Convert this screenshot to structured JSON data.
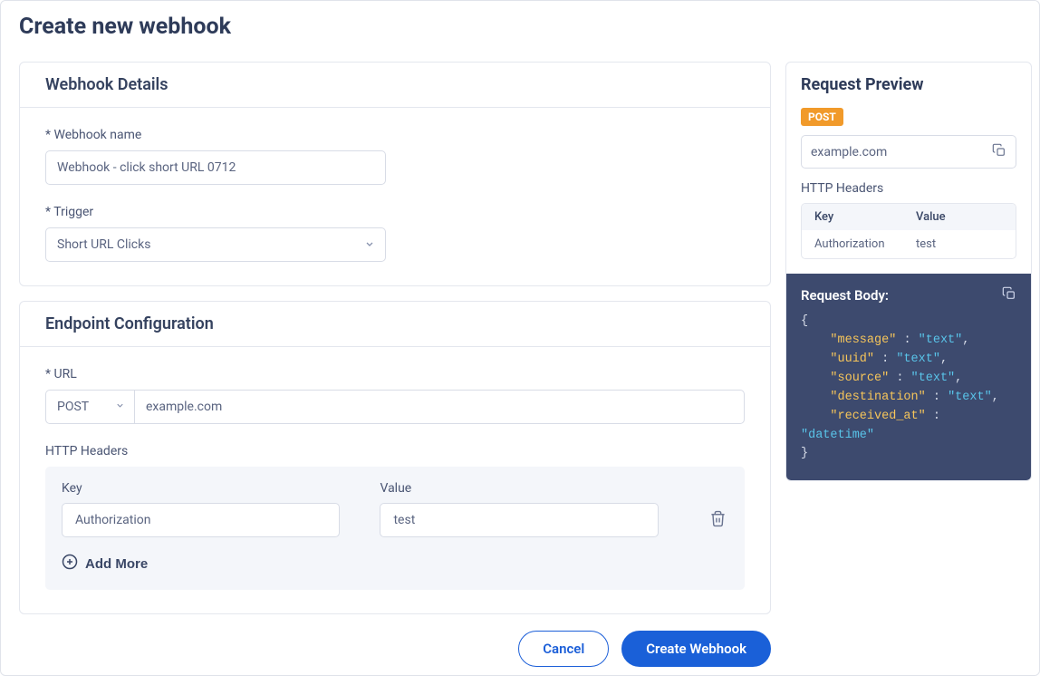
{
  "page_title": "Create new webhook",
  "details": {
    "section_title": "Webhook Details",
    "name_label": "* Webhook name",
    "name_value": "Webhook - click short URL 0712",
    "trigger_label": "* Trigger",
    "trigger_value": "Short URL Clicks"
  },
  "endpoint": {
    "section_title": "Endpoint Configuration",
    "url_label": "* URL",
    "method": "POST",
    "url_value": "example.com",
    "headers_label": "HTTP Headers",
    "key_label": "Key",
    "value_label": "Value",
    "rows": [
      {
        "key": "Authorization",
        "value": "test"
      }
    ],
    "add_more_label": "Add More"
  },
  "actions": {
    "cancel": "Cancel",
    "create": "Create Webhook"
  },
  "preview": {
    "title": "Request Preview",
    "method_badge": "POST",
    "url": "example.com",
    "headers_label": "HTTP Headers",
    "table_head_key": "Key",
    "table_head_value": "Value",
    "headers": [
      {
        "key": "Authorization",
        "value": "test"
      }
    ],
    "body_title": "Request Body:",
    "body_schema": {
      "message": "text",
      "uuid": "text",
      "source": "text",
      "destination": "text",
      "received_at": "datetime"
    }
  }
}
